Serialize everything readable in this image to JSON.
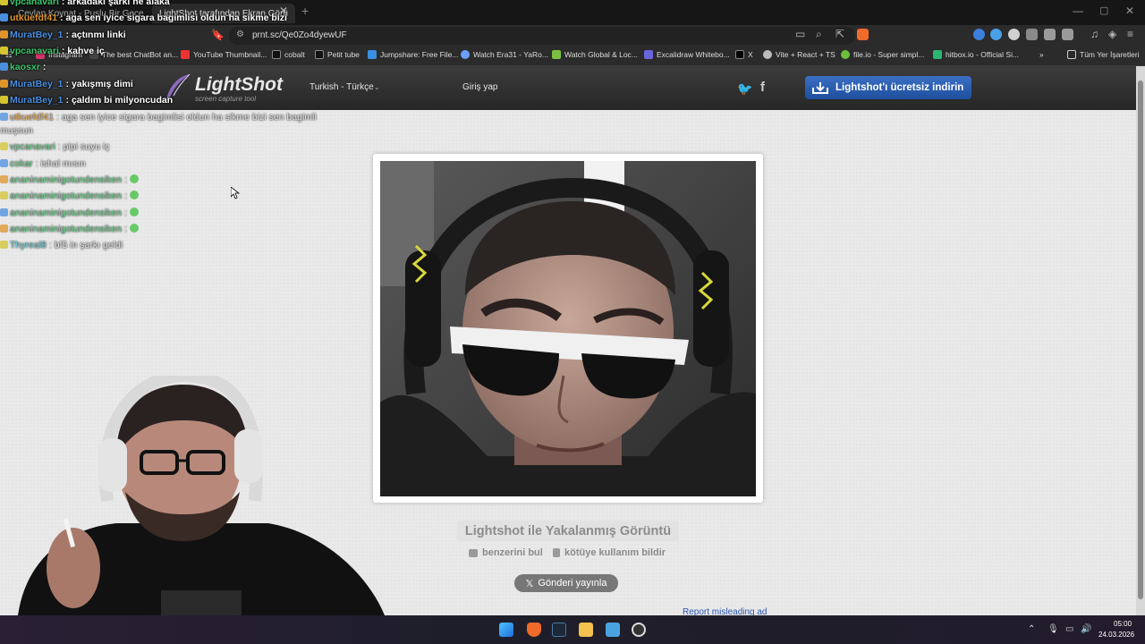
{
  "browser": {
    "tabs": [
      {
        "title": "Ceylan Koynat - Puslu Bir Gece (",
        "active": false
      },
      {
        "title": "LightShot tarafından Ekran Görü",
        "active": true
      }
    ],
    "url": "prnt.sc/Qe0Zo4dyewUF",
    "bookmarks": [
      "Instagram",
      "The best ChatBot an...",
      "YouTube Thumbnail...",
      "cobalt",
      "Petit tube",
      "Jumpshare: Free File...",
      "Watch Era31 - YaRo...",
      "Watch Global & Loc...",
      "Excalidraw Whitebo...",
      "X",
      "Vite + React + TS",
      "file.io - Super simpl...",
      "hitbox.io - Official Si..."
    ],
    "bookmarks_all": "Tüm Yer İşaretleri"
  },
  "lightshot": {
    "logo_name": "LightShot",
    "logo_tagline": "screen capture tool",
    "language": "Turkish - Türkçe",
    "login": "Giriş yap",
    "download": "Lightshot'ı ücretsiz indirin",
    "caption": "Lightshot ile Yakalanmış Görüntü",
    "find_similar": "benzerini bul",
    "report_abuse": "kötüye kullanım bildir",
    "post": "Gönderi yayınla",
    "report_misleading": "Report misleading ad"
  },
  "chat": [
    {
      "name": "vpcanavari",
      "msg": ": arkadaki şarkı ne alaka",
      "color": "#3cc46a",
      "faded": false
    },
    {
      "name": "utkuefdf41",
      "msg": ": aga sen iyice sigara bagimlisi oldun ha sikme bizi",
      "color": "#e0952a",
      "faded": false
    },
    {
      "name": "MuratBey_1",
      "msg": ": açtınmı linki",
      "color": "#4a8fe0",
      "faded": false
    },
    {
      "name": "vpcanavari",
      "msg": ": kahve iç",
      "color": "#3cc46a",
      "faded": false
    },
    {
      "name": "kaosxr",
      "msg": ":",
      "color": "#3cc46a",
      "faded": false
    },
    {
      "name": "MuratBey_1",
      "msg": ": yakışmış dimi",
      "color": "#4a8fe0",
      "faded": false
    },
    {
      "name": "MuratBey_1",
      "msg": ": çaldım bi milyoncudan",
      "color": "#4a8fe0",
      "faded": false
    },
    {
      "name": "utkuefdf41",
      "msg": ": aga sen iyice sigara bagimlisi oldun ha sikme bizi sen bagimli",
      "color": "#e0952a",
      "faded": true
    },
    {
      "name": "",
      "msg": "muşsun",
      "color": "#e0952a",
      "faded": true
    },
    {
      "name": "vpcanavari",
      "msg": ": pipi suyu iç",
      "color": "#3cc46a",
      "faded": true
    },
    {
      "name": "cokar",
      "msg": ": ishal mısın",
      "color": "#3cc46a",
      "faded": true
    },
    {
      "name": "ananinaminigotundensiken",
      "msg": ":",
      "color": "#3cc46a",
      "faded": true
    },
    {
      "name": "ananinaminigotundensiken",
      "msg": ":",
      "color": "#3cc46a",
      "faded": true
    },
    {
      "name": "ananinaminigotundensiken",
      "msg": ":",
      "color": "#3cc46a",
      "faded": true
    },
    {
      "name": "ananinaminigotundensiken",
      "msg": ":",
      "color": "#3cc46a",
      "faded": true
    },
    {
      "name": "Thyreal8",
      "msg": ": bf5 in şarkı geldi",
      "color": "#4ac0c8",
      "faded": true
    }
  ],
  "taskbar": {
    "time": "05:00",
    "date": "24.03.2026"
  }
}
